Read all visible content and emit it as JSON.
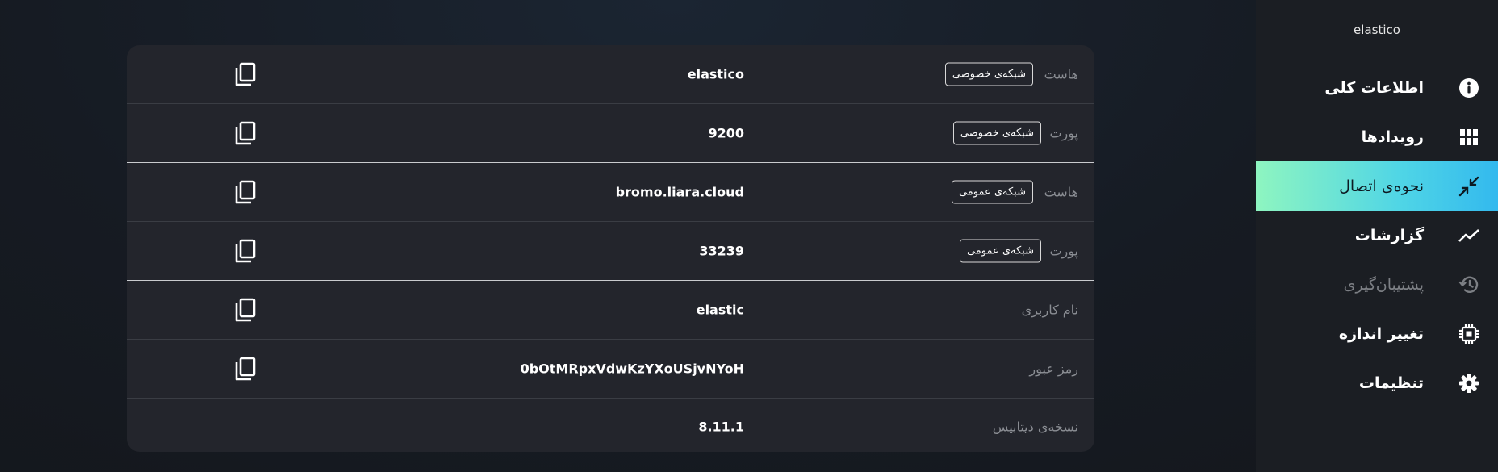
{
  "sidebar": {
    "title": "elastico",
    "items": [
      {
        "label": "اطلاعات کلی",
        "icon": "info-icon",
        "state": "normal"
      },
      {
        "label": "رویدادها",
        "icon": "grid-icon",
        "state": "normal"
      },
      {
        "label": "نحوه‌ی اتصال",
        "icon": "connect-arrows-icon",
        "state": "active"
      },
      {
        "label": "گزارشات",
        "icon": "trending-line-icon",
        "state": "normal"
      },
      {
        "label": "پشتیبان‌گیری",
        "icon": "history-icon",
        "state": "disabled"
      },
      {
        "label": "تغییر اندازه",
        "icon": "chip-icon",
        "state": "normal"
      },
      {
        "label": "تنظیمات",
        "icon": "gear-icon",
        "state": "normal"
      }
    ]
  },
  "connection": {
    "rows": [
      {
        "label": "هاست",
        "badge": "شبکه‌ی خصوصی",
        "value": "elastico",
        "copy": true
      },
      {
        "label": "پورت",
        "badge": "شبکه‌ی خصوصی",
        "value": "9200",
        "copy": true
      },
      {
        "label": "هاست",
        "badge": "شبکه‌ی عمومی",
        "value": "bromo.liara.cloud",
        "copy": true
      },
      {
        "label": "پورت",
        "badge": "شبکه‌ی عمومی",
        "value": "33239",
        "copy": true
      },
      {
        "label": "نام کاربری",
        "badge": "",
        "value": "elastic",
        "copy": true
      },
      {
        "label": "رمز عبور",
        "badge": "",
        "value": "0bOtMRpxVdwKzYXoUSjvNYoH",
        "copy": true
      },
      {
        "label": "نسخه‌ی دیتابیس",
        "badge": "",
        "value": "8.11.1",
        "copy": false
      }
    ]
  },
  "colors": {
    "active_gradient_start": "#8ef5c0",
    "active_gradient_end": "#33b9ee",
    "card_bg": "#23252c",
    "sidebar_bg": "#1b1e23"
  }
}
